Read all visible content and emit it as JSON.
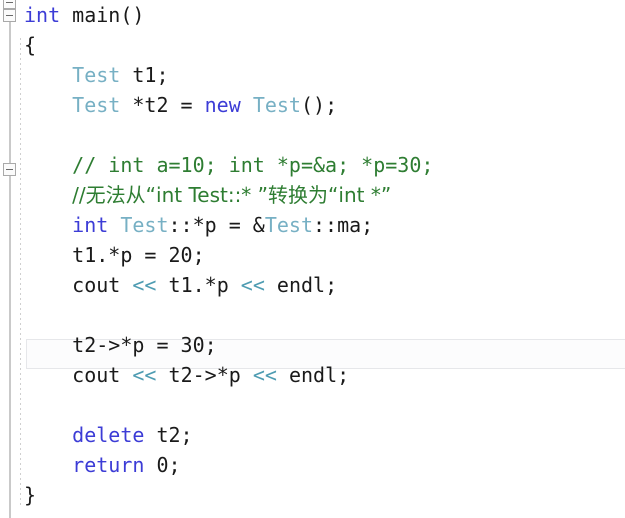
{
  "editor": {
    "language": "cpp",
    "colors": {
      "background": "#ffffff",
      "text": "#1a1a1a",
      "keyword": "#3c3cd6",
      "type": "#77b0c4",
      "operator": "#4e9cb2",
      "comment": "#2e7d32",
      "gutter_line": "#c9c9c9",
      "fold_marker_border": "#a9a9a9",
      "indent_guide": "#cfcfcf",
      "current_line_border": "#e6e7ea",
      "current_line_background": "#fcfcfd"
    },
    "fold_markers": [
      {
        "name": "fold-marker-above",
        "glyph": "−"
      },
      {
        "name": "fold-marker-main",
        "glyph": "−"
      },
      {
        "name": "fold-marker-inner",
        "glyph": "−"
      }
    ],
    "current_line_index": 11,
    "lines": [
      {
        "indent": 0,
        "tokens": [
          {
            "t": "int",
            "c": "kw"
          },
          {
            "t": " main()",
            "c": "plain"
          }
        ]
      },
      {
        "indent": 0,
        "tokens": [
          {
            "t": "{",
            "c": "plain"
          }
        ]
      },
      {
        "indent": 1,
        "tokens": [
          {
            "t": "Test",
            "c": "type"
          },
          {
            "t": " t1;",
            "c": "plain"
          }
        ]
      },
      {
        "indent": 1,
        "tokens": [
          {
            "t": "Test",
            "c": "type"
          },
          {
            "t": " *t2 = ",
            "c": "plain"
          },
          {
            "t": "new",
            "c": "kw"
          },
          {
            "t": " ",
            "c": "plain"
          },
          {
            "t": "Test",
            "c": "type"
          },
          {
            "t": "();",
            "c": "plain"
          }
        ]
      },
      {
        "indent": 0,
        "tokens": []
      },
      {
        "indent": 1,
        "tokens": [
          {
            "t": "// int a=10; int *p=&a; *p=30;",
            "c": "cmt"
          }
        ]
      },
      {
        "indent": 1,
        "tokens": [
          {
            "t": "//无法从“int Test::* ”转换为“int *”",
            "c": "cmt"
          }
        ]
      },
      {
        "indent": 1,
        "tokens": [
          {
            "t": "int",
            "c": "kw"
          },
          {
            "t": " ",
            "c": "plain"
          },
          {
            "t": "Test",
            "c": "type"
          },
          {
            "t": "::*p = &",
            "c": "plain"
          },
          {
            "t": "Test",
            "c": "type"
          },
          {
            "t": "::ma;",
            "c": "plain"
          }
        ]
      },
      {
        "indent": 1,
        "tokens": [
          {
            "t": "t1.*p = 20;",
            "c": "plain"
          }
        ]
      },
      {
        "indent": 1,
        "tokens": [
          {
            "t": "cout ",
            "c": "plain"
          },
          {
            "t": "<<",
            "c": "op"
          },
          {
            "t": " t1.*p ",
            "c": "plain"
          },
          {
            "t": "<<",
            "c": "op"
          },
          {
            "t": " endl;",
            "c": "plain"
          }
        ]
      },
      {
        "indent": 0,
        "tokens": []
      },
      {
        "indent": 1,
        "tokens": [
          {
            "t": "t2->*p = 30;",
            "c": "plain"
          }
        ]
      },
      {
        "indent": 1,
        "tokens": [
          {
            "t": "cout ",
            "c": "plain"
          },
          {
            "t": "<<",
            "c": "op"
          },
          {
            "t": " t2->*p ",
            "c": "plain"
          },
          {
            "t": "<<",
            "c": "op"
          },
          {
            "t": " endl;",
            "c": "plain"
          }
        ]
      },
      {
        "indent": 0,
        "tokens": []
      },
      {
        "indent": 1,
        "tokens": [
          {
            "t": "delete",
            "c": "kw"
          },
          {
            "t": " t2;",
            "c": "plain"
          }
        ]
      },
      {
        "indent": 1,
        "tokens": [
          {
            "t": "return",
            "c": "kw"
          },
          {
            "t": " 0;",
            "c": "plain"
          }
        ]
      },
      {
        "indent": 0,
        "tokens": [
          {
            "t": "}",
            "c": "plain"
          }
        ]
      }
    ]
  }
}
